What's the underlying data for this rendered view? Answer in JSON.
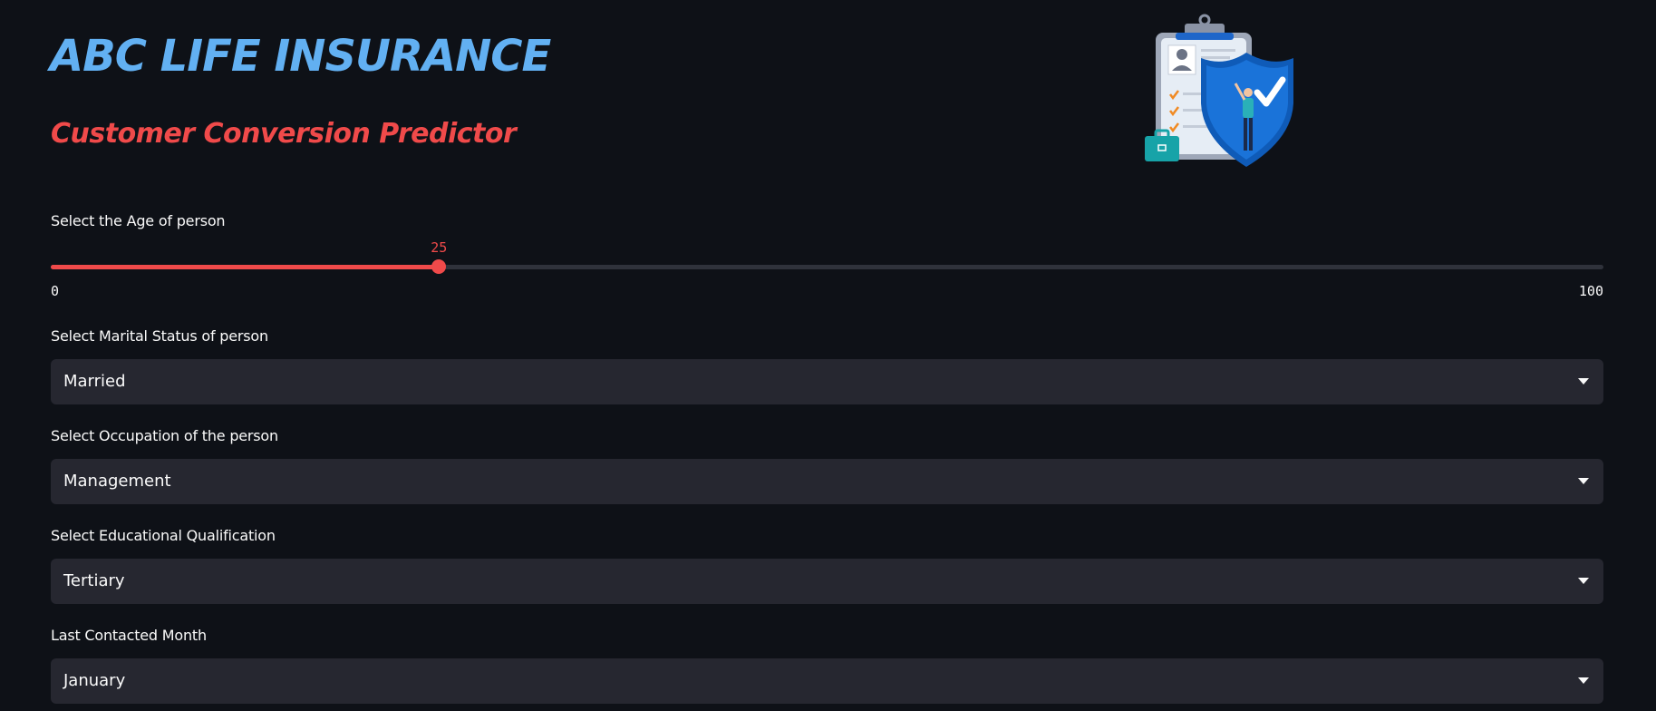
{
  "header": {
    "title": "ABC LIFE INSURANCE",
    "subtitle": "Customer Conversion Predictor",
    "illustration_icon": "insurance-clipboard-shield-illustration"
  },
  "colors": {
    "background": "#0e1117",
    "title": "#62b0f2",
    "accent": "#f04a4a",
    "input_background": "#262730"
  },
  "age_slider": {
    "label": "Select the Age of person",
    "value": "25",
    "value_fraction": 0.25,
    "min": "0",
    "max": "100"
  },
  "marital_status": {
    "label": "Select Marital Status of person",
    "selected": "Married"
  },
  "occupation": {
    "label": "Select Occupation of the person",
    "selected": "Management"
  },
  "education": {
    "label": "Select Educational Qualification",
    "selected": "Tertiary"
  },
  "last_contacted_month": {
    "label": "Last Contacted Month",
    "selected": "January"
  }
}
